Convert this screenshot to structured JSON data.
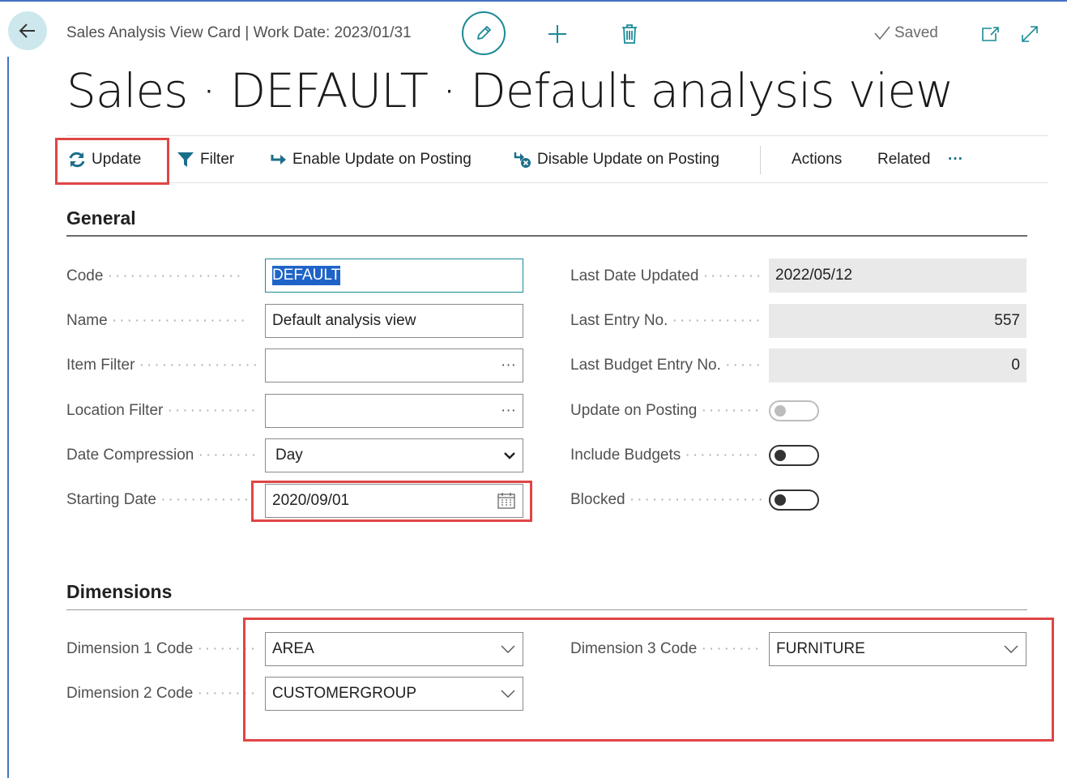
{
  "header": {
    "caption": "Sales Analysis View Card | Work Date: 2023/01/31",
    "status": "Saved",
    "title": "Sales · DEFAULT · Default analysis view"
  },
  "actions": {
    "update": "Update",
    "filter": "Filter",
    "enable_update": "Enable Update on Posting",
    "disable_update": "Disable Update on Posting",
    "actions_menu": "Actions",
    "related_menu": "Related",
    "more": "···"
  },
  "general": {
    "title": "General",
    "code": {
      "label": "Code",
      "value": "DEFAULT"
    },
    "name": {
      "label": "Name",
      "value": "Default analysis view"
    },
    "item_filter": {
      "label": "Item Filter",
      "value": "",
      "assist": "···"
    },
    "location_filter": {
      "label": "Location Filter",
      "value": "",
      "assist": "···"
    },
    "date_compression": {
      "label": "Date Compression",
      "value": "Day"
    },
    "starting_date": {
      "label": "Starting Date",
      "value": "2020/09/01"
    },
    "last_date_updated": {
      "label": "Last Date Updated",
      "value": "2022/05/12"
    },
    "last_entry_no": {
      "label": "Last Entry No.",
      "value": "557"
    },
    "last_budget_entry_no": {
      "label": "Last Budget Entry No.",
      "value": "0"
    },
    "update_on_posting": {
      "label": "Update on Posting",
      "value": false
    },
    "include_budgets": {
      "label": "Include Budgets",
      "value": false
    },
    "blocked": {
      "label": "Blocked",
      "value": false
    }
  },
  "dimensions": {
    "title": "Dimensions",
    "dim1": {
      "label": "Dimension 1 Code",
      "value": "AREA"
    },
    "dim2": {
      "label": "Dimension 2 Code",
      "value": "CUSTOMERGROUP"
    },
    "dim3": {
      "label": "Dimension 3 Code",
      "value": "FURNITURE"
    }
  },
  "colors": {
    "accent": "#1b8a96",
    "highlight": "#e04545",
    "selection": "#1e64c8"
  }
}
